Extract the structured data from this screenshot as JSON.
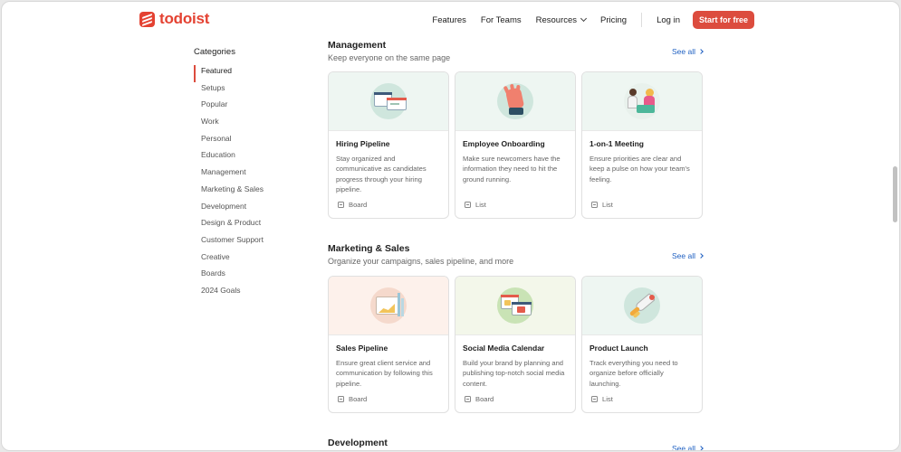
{
  "brand": {
    "name": "todoist",
    "color": "#e44232"
  },
  "nav": {
    "items": [
      "Features",
      "For Teams",
      "Resources",
      "Pricing"
    ],
    "login": "Log in",
    "cta": "Start for free"
  },
  "sidebar": {
    "title": "Categories",
    "items": [
      "Featured",
      "Setups",
      "Popular",
      "Work",
      "Personal",
      "Education",
      "Management",
      "Marketing & Sales",
      "Development",
      "Design & Product",
      "Customer Support",
      "Creative",
      "Boards",
      "2024 Goals"
    ],
    "active": "Featured"
  },
  "sections": [
    {
      "title": "Management",
      "subtitle": "Keep everyone on the same page",
      "see_all": "See all",
      "cards": [
        {
          "title": "Hiring Pipeline",
          "desc": "Stay organized and communicative as candidates progress through your hiring pipeline.",
          "type": "Board",
          "icon": "hiring-board-illustration",
          "bg": "#eef6f2"
        },
        {
          "title": "Employee Onboarding",
          "desc": "Make sure newcomers have the information they need to hit the ground running.",
          "type": "List",
          "icon": "waving-hand-illustration",
          "bg": "#eef6f2"
        },
        {
          "title": "1-on-1 Meeting",
          "desc": "Ensure priorities are clear and keep a pulse on how your team's feeling.",
          "type": "List",
          "icon": "meeting-people-illustration",
          "bg": "#eef6f2"
        }
      ]
    },
    {
      "title": "Marketing & Sales",
      "subtitle": "Organize your campaigns, sales pipeline, and more",
      "see_all": "See all",
      "cards": [
        {
          "title": "Sales Pipeline",
          "desc": "Ensure great client service and communication by following this pipeline.",
          "type": "Board",
          "icon": "sales-chart-illustration",
          "bg": "#fdf1eb"
        },
        {
          "title": "Social Media Calendar",
          "desc": "Build your brand by planning and publishing top-notch social media content.",
          "type": "Board",
          "icon": "social-calendar-illustration",
          "bg": "#f3f7ea"
        },
        {
          "title": "Product Launch",
          "desc": "Track everything you need to organize before officially launching.",
          "type": "List",
          "icon": "rocket-illustration",
          "bg": "#eef6f2"
        }
      ]
    },
    {
      "title": "Development",
      "see_all": "See all"
    }
  ]
}
